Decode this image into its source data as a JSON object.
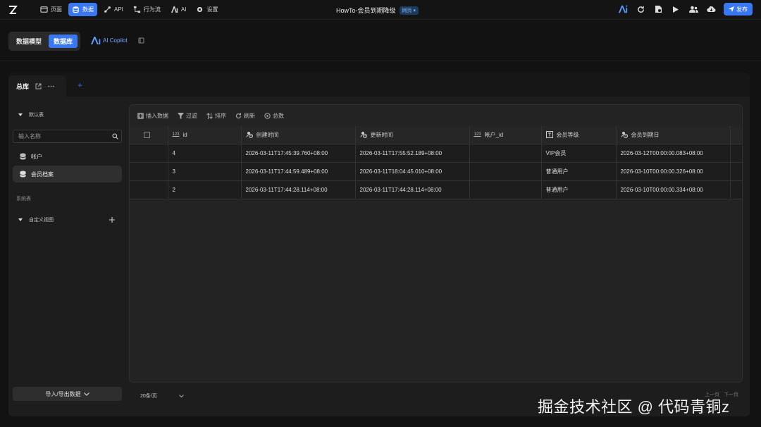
{
  "topbar": {
    "nav": [
      {
        "label": "页面",
        "icon": "page-icon"
      },
      {
        "label": "数据",
        "icon": "database-icon",
        "active": true
      },
      {
        "label": "API",
        "icon": "api-icon"
      },
      {
        "label": "行为流",
        "icon": "flow-icon"
      },
      {
        "label": "AI",
        "icon": "ai-icon"
      },
      {
        "label": "设置",
        "icon": "gear-icon"
      }
    ],
    "title": "HowTo-会员到期降级",
    "title_badge": "网页 ▾",
    "publish_label": "发布"
  },
  "subbar": {
    "seg_model": "数据模型",
    "seg_db": "数据库",
    "copilot": "AI Copilot"
  },
  "tab": {
    "label": "总库",
    "add": "+"
  },
  "sidebar": {
    "group_default": "默认表",
    "search_placeholder": "输入名称",
    "items": [
      {
        "label": "帐户"
      },
      {
        "label": "会员档案",
        "active": true
      }
    ],
    "system_label": "系统表",
    "group_custom": "自定义视图",
    "io_button": "导入/导出数据"
  },
  "toolbar": {
    "insert": "插入数据",
    "filter": "过滤",
    "sort": "排序",
    "refresh": "刷新",
    "total": "总数"
  },
  "table": {
    "columns": [
      "id",
      "创建时间",
      "更新时间",
      "帐户_id",
      "会员等级",
      "会员到期日"
    ],
    "rows": [
      [
        "4",
        "2026-03-11T17:45:39.760+08:00",
        "2026-03-11T17:55:52.189+08:00",
        "",
        "VIP会员",
        "2026-03-12T00:00:00.083+08:00"
      ],
      [
        "3",
        "2026-03-11T17:44:59.489+08:00",
        "2026-03-11T18:04:45.010+08:00",
        "",
        "普通用户",
        "2026-03-10T00:00:00.326+08:00"
      ],
      [
        "2",
        "2026-03-11T17:44:28.114+08:00",
        "2026-03-11T17:44:28.114+08:00",
        "",
        "普通用户",
        "2026-03-10T00:00:00.334+08:00"
      ]
    ]
  },
  "footer": {
    "per_page": "20条/页",
    "prev": "上一页",
    "next": "下一页"
  },
  "watermark": "掘金技术社区 @ 代码青铜z",
  "colors": {
    "accent": "#3a78f2",
    "background": "#121212",
    "panel": "#1d1d1d"
  }
}
